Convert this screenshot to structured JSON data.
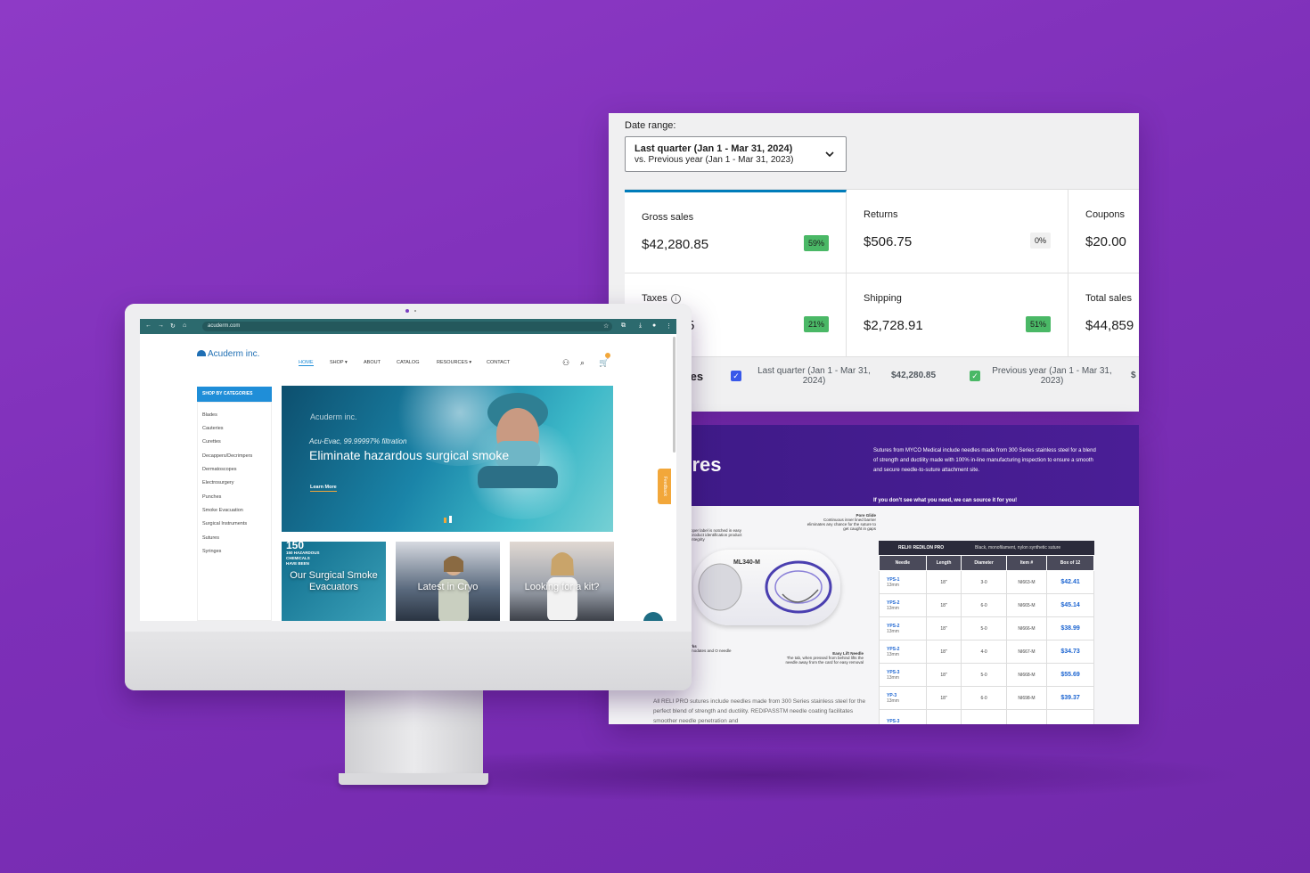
{
  "analytics": {
    "date_range_label": "Date range:",
    "date_range_value": "Last quarter (Jan 1 - Mar 31, 2024)",
    "date_range_compare": "vs. Previous year (Jan 1 - Mar 31, 2023)",
    "cards": [
      {
        "label": "Gross sales",
        "value": "$42,280.85",
        "change": "59%"
      },
      {
        "label": "Returns",
        "value": "$506.75",
        "change": "0%"
      },
      {
        "label": "Coupons",
        "value": "$20.00"
      },
      {
        "label": "Taxes",
        "value": "5",
        "change": "21%"
      },
      {
        "label": "Shipping",
        "value": "$2,728.91",
        "change": "51%"
      },
      {
        "label": "Total sales",
        "value": "$44,859"
      }
    ],
    "legend": {
      "section_fragment": "les",
      "current_label": "Last quarter (Jan 1 - Mar 31, 2024)",
      "current_value": "$42,280.85",
      "previous_label": "Previous year (Jan 1 - Mar 31, 2023)",
      "previous_fragment": "$"
    },
    "colors": {
      "accent": "#007cba",
      "positive": "#4ab866",
      "current_check": "#3858e9",
      "previous_check": "#4ab866"
    }
  },
  "suture_doc": {
    "title_fragment": "ures",
    "subtitle_fragment": "res",
    "intro": "Sutures from MYCO Medical include needles made from 300 Series stainless steel for a blend of strength and ductility made with 100% in-line manufacturing inspection to ensure a smooth and secure needle-to-suture attachment site.",
    "callout": "If you don't see what you need, we can source it for you!",
    "pack_label": "ML340-M",
    "notes": {
      "pore_glide_title": "Pore Glide",
      "pore_glide_text": "Continuous inner lined barrier eliminates any chance for the suture to get caught in gaps",
      "label_text": "oper label is notched in easy product identification product integrity",
      "marks_title": "rks",
      "marks_text": "modates and O needle",
      "easy_lift_title": "Easy Lift Needle",
      "easy_lift_text": "The tab, when pressed from behind lifts the needle away from the card for easy removal"
    },
    "footer_text": "All RELI PRO sutures include needles made from 300 Series stainless steel for the perfect blend of strength and ductility. REDIPASSTM needle coating facilitates smoother needle penetration and",
    "table": {
      "brand": "RELI® REDILON PRO",
      "description": "Black, monofilament, nylon synthetic suture",
      "columns": [
        "Needle",
        "Length",
        "Diameter",
        "Item #",
        "Box of 12"
      ],
      "rows": [
        {
          "needle": "YPS-1",
          "needle_size": "13mm",
          "length": "18\"",
          "diameter": "3-0",
          "item": "NI663-M",
          "price": "$42.41"
        },
        {
          "needle": "YPS-2",
          "needle_size": "13mm",
          "length": "18\"",
          "diameter": "6-0",
          "item": "NI665-M",
          "price": "$45.14"
        },
        {
          "needle": "YPS-2",
          "needle_size": "13mm",
          "length": "18\"",
          "diameter": "5-0",
          "item": "NI666-M",
          "price": "$38.99"
        },
        {
          "needle": "YPS-2",
          "needle_size": "13mm",
          "length": "18\"",
          "diameter": "4-0",
          "item": "NI667-M",
          "price": "$34.73"
        },
        {
          "needle": "YPS-3",
          "needle_size": "13mm",
          "length": "18\"",
          "diameter": "5-0",
          "item": "NI668-M",
          "price": "$55.69"
        },
        {
          "needle": "YP-3",
          "needle_size": "13mm",
          "length": "18\"",
          "diameter": "6-0",
          "item": "NI698-M",
          "price": "$39.37"
        },
        {
          "needle": "YPS-3",
          "needle_size": "",
          "length": "",
          "diameter": "",
          "item": "",
          "price": ""
        }
      ]
    }
  },
  "website": {
    "url": "acuderm.com",
    "logo": "Acuderm inc.",
    "menu": [
      "HOME",
      "SHOP",
      "ABOUT",
      "CATALOG",
      "RESOURCES",
      "CONTACT"
    ],
    "categories_heading": "SHOP BY CATEGORIES",
    "categories": [
      "Blades",
      "Cauteries",
      "Curettes",
      "Decappers/Decrimpers",
      "Dermatoscopes",
      "Electrosurgery",
      "Punches",
      "Smoke Evacuation",
      "Surgical Instruments",
      "Sutures",
      "Syringes"
    ],
    "hero": {
      "logo": "Acuderm inc.",
      "kicker": "Acu-Evac, 99.99997% filtration",
      "title": "Eliminate hazardous surgical smoke",
      "cta": "Learn More"
    },
    "tiles": [
      {
        "overlay": "150 HAZARDOUS CHEMICALS HAVE BEEN",
        "label": "Our Surgical Smoke Evacuators"
      },
      {
        "label": "Latest in Cryo"
      },
      {
        "label": "Looking for a kit?"
      }
    ],
    "feedback": "Feedback",
    "colors": {
      "chrome": "#2c6a6e",
      "primary": "#1f8ed8",
      "accent": "#f2a73a"
    }
  }
}
